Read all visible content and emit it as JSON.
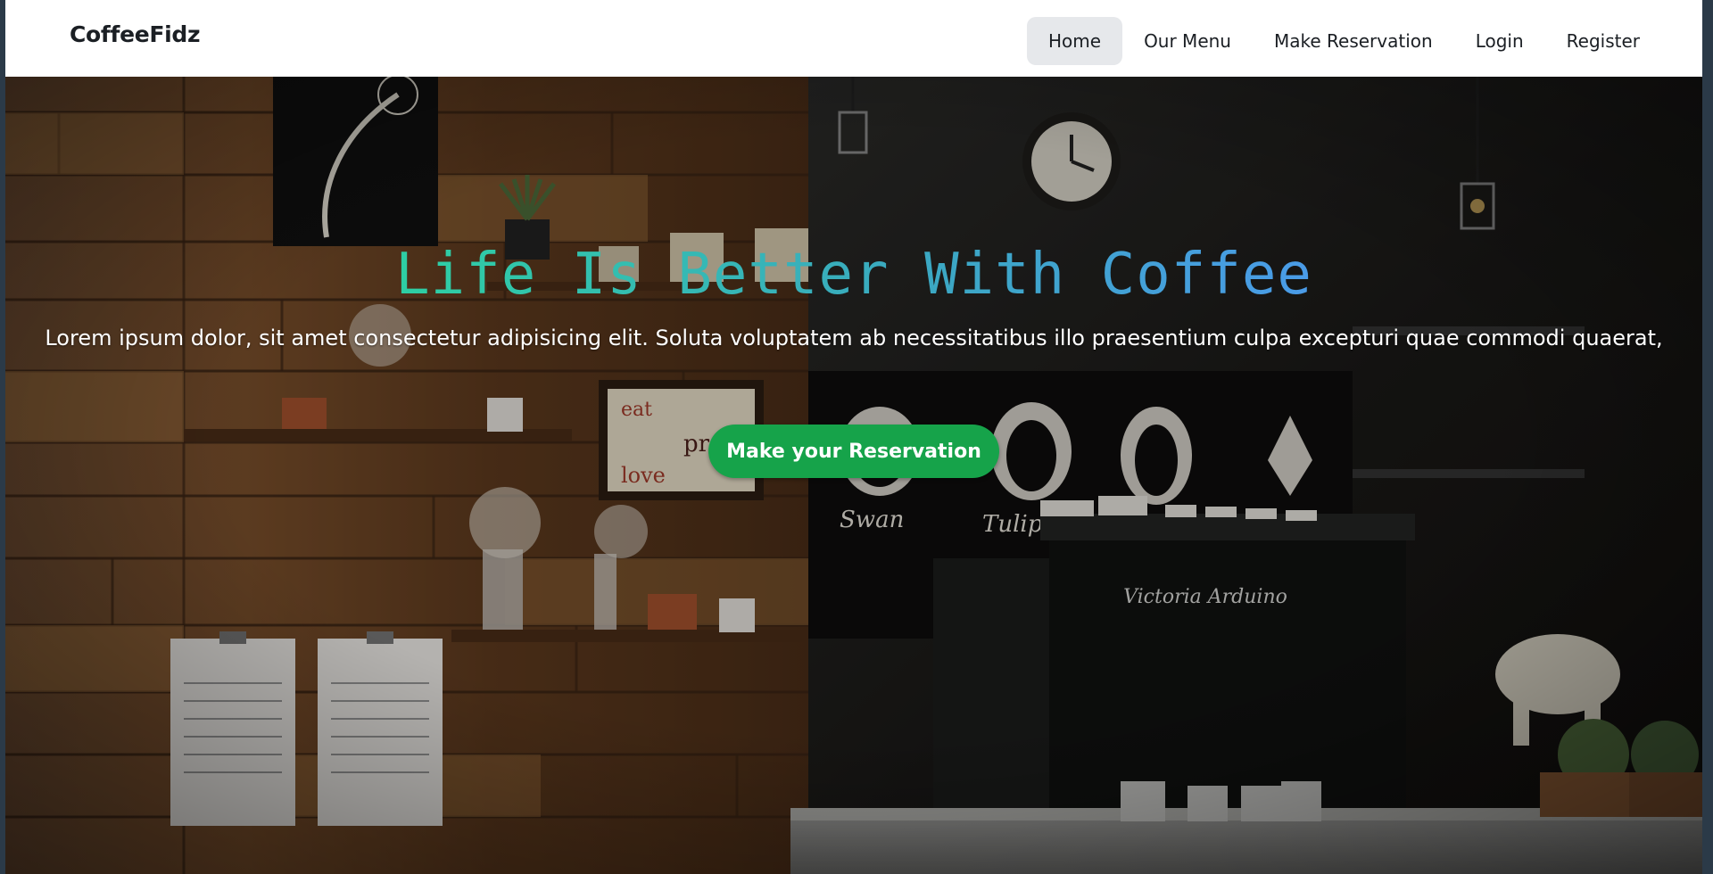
{
  "navbar": {
    "brand": "CoffeeFidz",
    "links": [
      {
        "label": "Home",
        "active": true
      },
      {
        "label": "Our Menu",
        "active": false
      },
      {
        "label": "Make Reservation",
        "active": false
      },
      {
        "label": "Login",
        "active": false
      },
      {
        "label": "Register",
        "active": false
      }
    ]
  },
  "hero": {
    "title": "Life Is Better With Coffee",
    "subtitle": "Lorem ipsum dolor, sit amet consectetur adipisicing elit. Soluta voluptatem ab necessitatibus illo praesentium culpa excepturi quae commodi quaerat,",
    "cta_label": "Make your Reservation",
    "machine_brand": "Victoria Arduino",
    "latte_art": [
      "Swan",
      "Tulip"
    ],
    "menu_board": [
      "eat",
      "pray",
      "love"
    ]
  },
  "colors": {
    "cta": "#16a34a",
    "title_gradient_start": "#2ecfa3",
    "title_gradient_end": "#4a9be8",
    "nav_active_bg": "#e6e8eb"
  }
}
